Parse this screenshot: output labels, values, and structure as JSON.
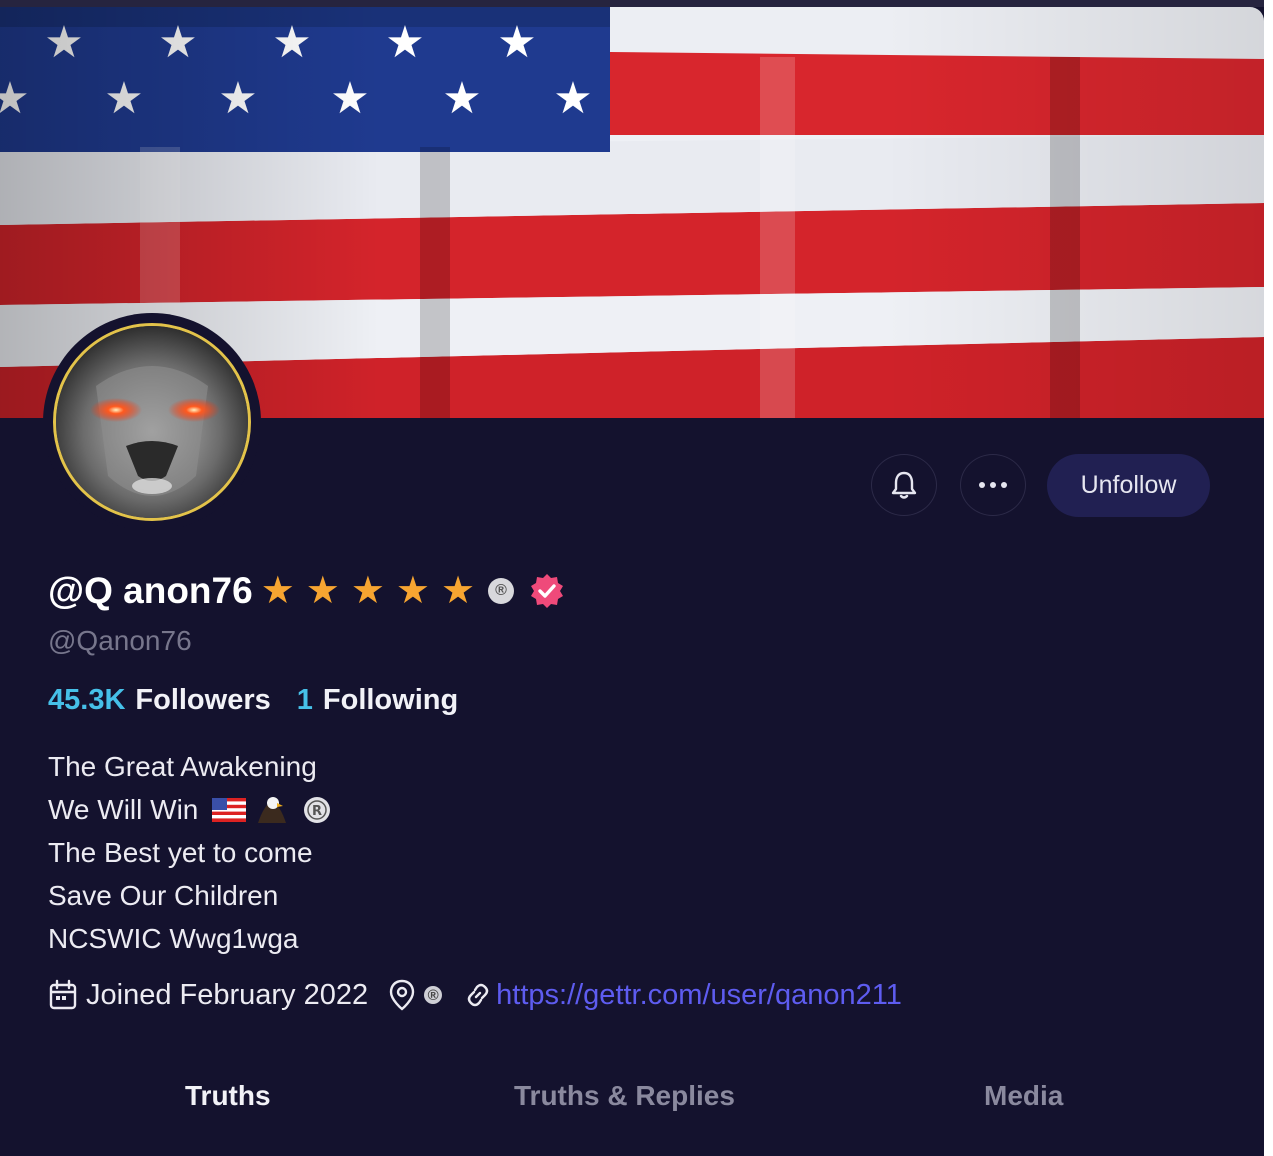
{
  "profile": {
    "display_name": "@Q anon76",
    "stars": [
      "★",
      "★",
      "★",
      "★",
      "★"
    ],
    "registered_mark": "®",
    "verified_icon": "verified-badge-icon",
    "handle": "@Qanon76",
    "followers_count": "45.3K",
    "followers_label": "Followers",
    "following_count": "1",
    "following_label": "Following",
    "bio": [
      "The Great Awakening",
      "We Will Win",
      "The Best yet to come",
      "Save Our Children",
      "NCSWIC Wwg1wga"
    ],
    "bio_emojis": [
      "us-flag-emoji",
      "eagle-emoji",
      "registered-emoji"
    ],
    "joined": "Joined February 2022",
    "location_mark": "®",
    "link": "https://gettr.com/user/qanon211"
  },
  "actions": {
    "bell_icon": "bell-icon",
    "more_icon": "ellipsis-icon",
    "unfollow_label": "Unfollow"
  },
  "tabs": [
    {
      "label": "Truths",
      "active": true
    },
    {
      "label": "Truths & Replies",
      "active": false
    },
    {
      "label": "Media",
      "active": false
    }
  ],
  "colors": {
    "background": "#14122e",
    "accent_link": "#5e5cf0",
    "stat_number": "#46c0e8",
    "star": "#f7a531",
    "button": "#212052",
    "verified": "#ef4a7a"
  }
}
